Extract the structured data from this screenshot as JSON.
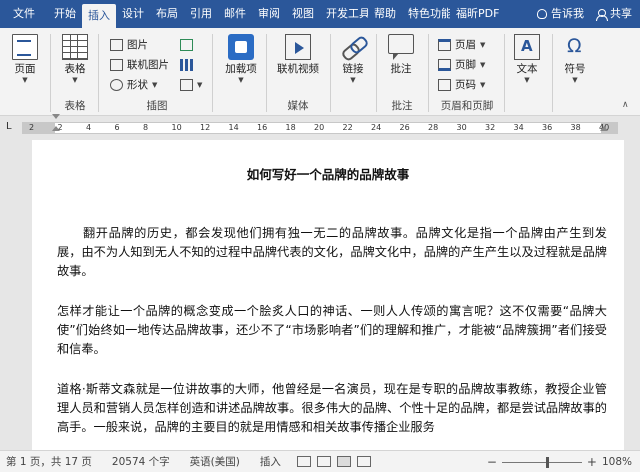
{
  "tabs": [
    "文件",
    "开始",
    "插入",
    "设计",
    "布局",
    "引用",
    "邮件",
    "审阅",
    "视图",
    "开发工具",
    "帮助",
    "特色功能",
    "福昕PDF"
  ],
  "active_tab_index": 2,
  "tell_me": "告诉我",
  "share": "共享",
  "ribbon": {
    "page": "页面",
    "table": "表格",
    "picture": "图片",
    "online_picture": "联机图片",
    "shapes": "形状",
    "addin": "加载项",
    "online_video": "联机视频",
    "link": "链接",
    "comment": "批注",
    "header": "页眉",
    "footer": "页脚",
    "page_number": "页码",
    "text": "文本",
    "symbol": "符号",
    "groups": {
      "table": "表格",
      "illustrations": "插图",
      "media": "媒体",
      "comments": "批注",
      "header_footer": "页眉和页脚"
    }
  },
  "ruler": {
    "ticks": [
      "2",
      "2",
      "4",
      "6",
      "8",
      "10",
      "12",
      "14",
      "16",
      "18",
      "20",
      "22",
      "24",
      "26",
      "28",
      "30",
      "32",
      "34",
      "36",
      "38",
      "40"
    ]
  },
  "document": {
    "title": "如何写好一个品牌的品牌故事",
    "paragraphs": [
      "翻开品牌的历史，都会发现他们拥有独一无二的品牌故事。品牌文化是指一个品牌由产生到发展，由不为人知到无人不知的过程中品牌代表的文化，品牌文化中，品牌的产生产生以及过程就是品牌故事。",
      "怎样才能让一个品牌的概念变成一个脍炙人口的神话、一则人人传颂的寓言呢？这不仅需要“品牌大使”们始终如一地传达品牌故事，还少不了“市场影响者”们的理解和推广，才能被“品牌簇拥”者们接受和信奉。",
      "道格·斯蒂文森就是一位讲故事的大师，他曾经是一名演员，现在是专职的品牌故事教练，教授企业管理人员和营销人员怎样创造和讲述品牌故事。很多伟大的品牌、个性十足的品牌，都是尝试品牌故事的高手。一般来说，品牌的主要目的就是用情感和相关故事传播企业服务"
    ]
  },
  "status": {
    "page": "第 1 页，共 17 页",
    "words": "20574 个字",
    "language": "英语(美国)",
    "mode": "插入",
    "zoom_minus": "−",
    "zoom_plus": "+",
    "zoom": "108%"
  }
}
